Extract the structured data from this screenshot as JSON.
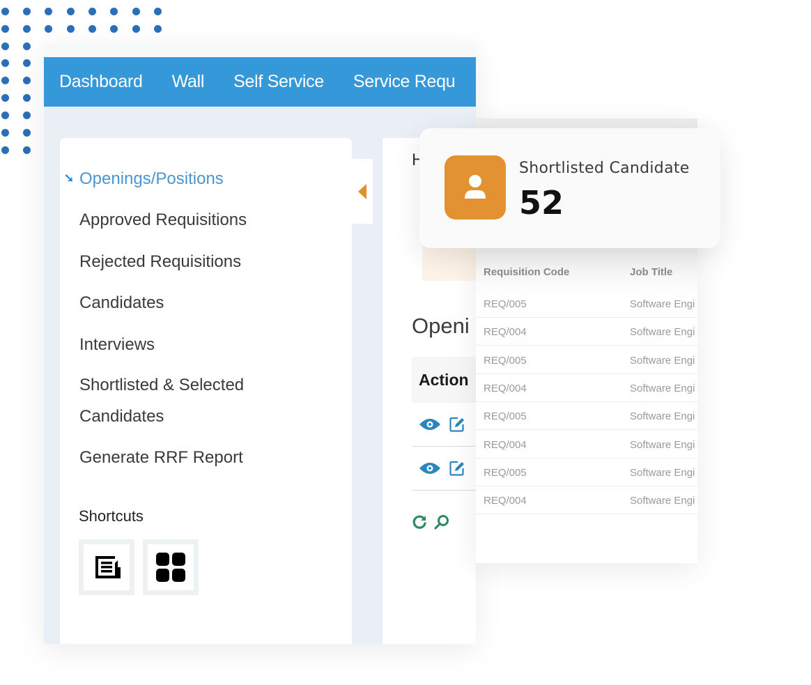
{
  "navbar": {
    "items": [
      "Dashboard",
      "Wall",
      "Self Service",
      "Service Requ"
    ]
  },
  "sidebar": {
    "active_item": "Openings/Positions",
    "items": [
      "Approved Requisitions",
      "Rejected Requisitions",
      "Candidates",
      "Interviews",
      "Shortlisted & Selected",
      "Candidates",
      "Generate RRF Report"
    ],
    "shortcuts_title": "Shortcuts",
    "shortcuts": [
      {
        "icon": "document-list-icon"
      },
      {
        "icon": "grid-apps-icon"
      }
    ]
  },
  "main": {
    "heading_partial": "H",
    "section_title": "Openi",
    "action_header": "Action",
    "row_actions": [
      "view-icon",
      "edit-icon"
    ]
  },
  "table": {
    "columns": [
      "Requisition Code",
      "Job Title"
    ],
    "rows": [
      [
        "REQ/005",
        "Software Engi"
      ],
      [
        "REQ/004",
        "Software Engi"
      ],
      [
        "REQ/005",
        "Software Engi"
      ],
      [
        "REQ/004",
        "Software Engi"
      ],
      [
        "REQ/005",
        "Software Engi"
      ],
      [
        "REQ/004",
        "Software Engi"
      ],
      [
        "REQ/005",
        "Software Engi"
      ],
      [
        "REQ/004",
        "Software Engi"
      ]
    ]
  },
  "stat_card": {
    "label": "Shortlisted Candidate",
    "value": "52",
    "accent_color": "#e39232"
  },
  "colors": {
    "navbar": "#3598d9",
    "dots": "#2a6fb7",
    "active_link": "#4b95d1",
    "action_icon": "#2b86c0",
    "utility_icon": "#2e8b5e"
  }
}
